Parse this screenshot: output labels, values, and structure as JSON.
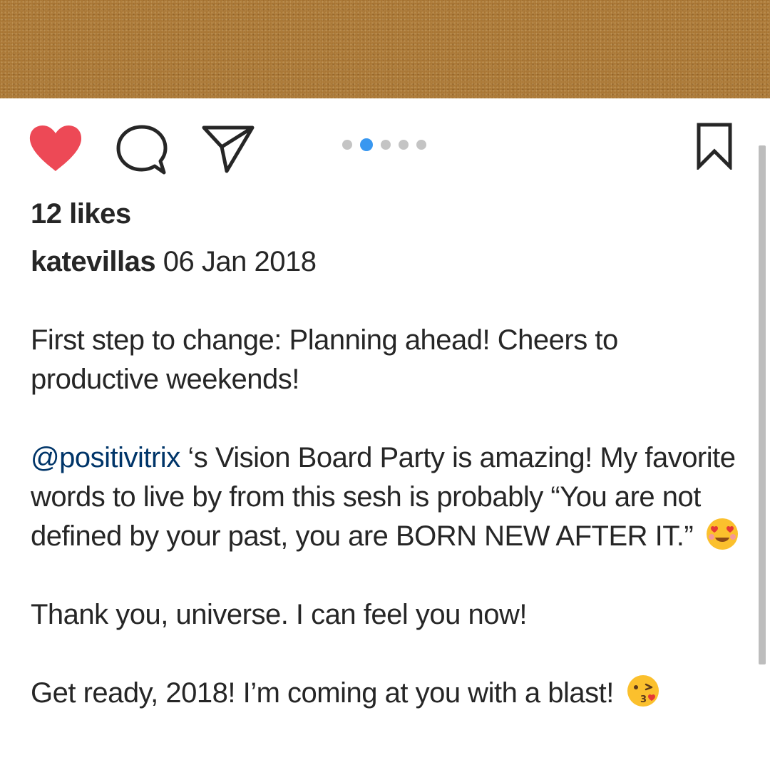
{
  "post": {
    "likes_text": "12 likes",
    "username": "katevillas",
    "date": "06 Jan 2018",
    "caption": {
      "p1": "First step to change: Planning ahead! Cheers to productive weekends!",
      "mention": "@positivitrix",
      "p2_rest": " ‘s Vision Board Party is amazing! My favorite words to live by from this sesh is probably “You are not defined by your past, you are BORN NEW AFTER IT.”",
      "p2_emoji": "smiling-face-with-heart-eyes-icon",
      "p3": "Thank you, universe. I can feel you now!",
      "p4": "Get ready, 2018! I’m coming at you with a blast!",
      "p4_emoji": "face-blowing-kiss-icon"
    }
  },
  "actions": {
    "like_icon": "heart-icon",
    "comment_icon": "comment-icon",
    "share_icon": "paper-plane-icon",
    "save_icon": "bookmark-icon"
  },
  "carousel": {
    "total": 5,
    "active_index": 1
  },
  "colors": {
    "like_red": "#ed4956",
    "dot_active": "#3897f0",
    "dot_inactive": "#c4c4c4",
    "mention": "#003569",
    "image_brown": "#a87533"
  }
}
